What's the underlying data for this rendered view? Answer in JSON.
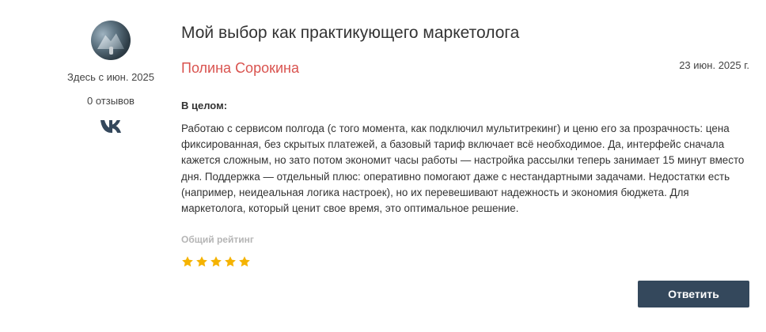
{
  "author_sidebar": {
    "member_since": "Здесь с июн. 2025",
    "reviews_count": "0 отзывов",
    "social_icon": "vk-icon"
  },
  "review": {
    "title": "Мой выбор как практикующего маркетолога",
    "author": "Полина Сорокина",
    "date": "23 июн. 2025 г.",
    "section_label": "В целом:",
    "body": "Работаю с сервисом полгода (с того момента, как подключил мультитрекинг) и ценю его за прозрачность: цена фиксированная, без скрытых платежей, а базовый тариф включает всё необходимое. Да, интерфейс сначала кажется сложным, но зато потом экономит часы работы — настройка рассылки теперь занимает 15 минут вместо дня. Поддержка — отдельный плюс: оперативно помогают даже с нестандартными задачами. Недостатки есть (например, неидеальная логика настроек), но их перевешивают надежность и экономия бюджета. Для маркетолога, который ценит свое время, это оптимальное решение.",
    "rating_label": "Общий рейтинг",
    "rating": 5,
    "rating_max": 5
  },
  "actions": {
    "reply_label": "Ответить"
  },
  "colors": {
    "author_name": "#d9534f",
    "star": "#f5b301",
    "button_bg": "#34485c",
    "rating_label": "#b5b5b5"
  }
}
